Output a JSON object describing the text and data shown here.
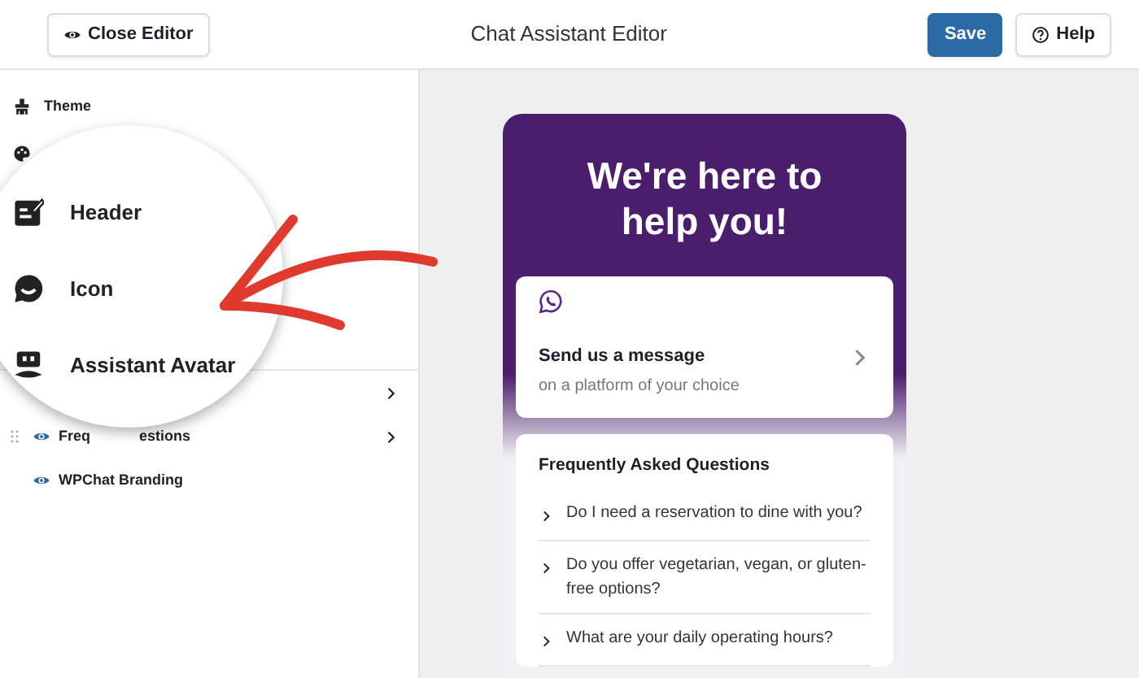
{
  "toolbar": {
    "close_button": "Close Editor",
    "title": "Chat Assistant Editor",
    "save_button": "Save",
    "help_button": "Help"
  },
  "sidebar": {
    "top_items": [
      {
        "kind": "brush",
        "label": "Theme"
      },
      {
        "kind": "palette"
      }
    ],
    "lower_rows": [
      {
        "expandable": true
      },
      {
        "label_start": "Freq",
        "label_end": "estions",
        "visible": true,
        "draggable": true,
        "expandable": true
      },
      {
        "label": "WPChat Branding",
        "visible": true,
        "expandable": false
      }
    ]
  },
  "magnifier": {
    "items": [
      {
        "kind": "edit",
        "label": "Header"
      },
      {
        "kind": "chat",
        "label": "Icon"
      },
      {
        "kind": "robot",
        "label": "Assistant Avatar"
      }
    ]
  },
  "preview": {
    "heading": "We're here to help you!",
    "message_card": {
      "title": "Send us a message",
      "subtitle": "on a platform of your choice"
    },
    "faq": {
      "title": "Frequently Asked Questions",
      "questions": [
        "Do I need a reservation to dine with you?",
        "Do you offer vegetarian, vegan, or gluten-free options?",
        "What are your daily operating hours?"
      ]
    }
  }
}
